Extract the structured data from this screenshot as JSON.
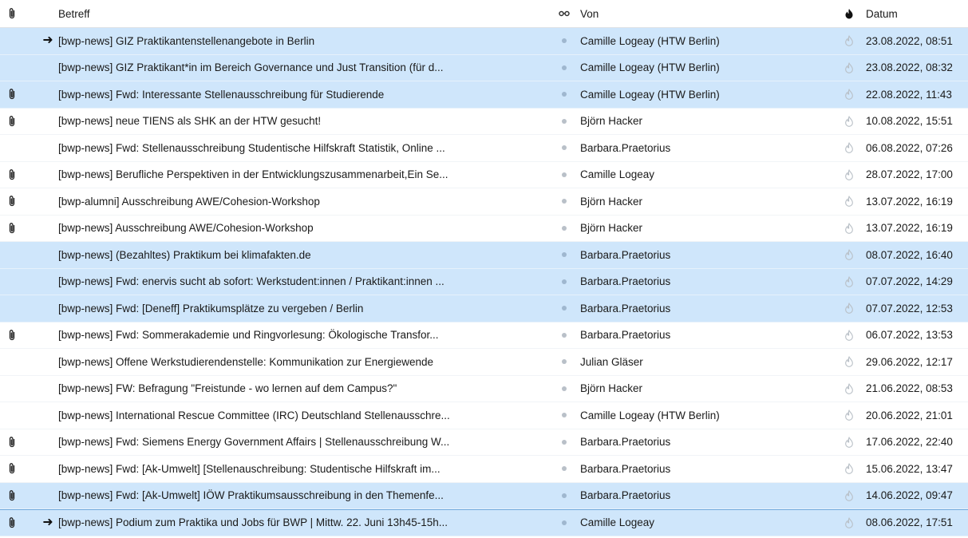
{
  "columns": {
    "subject": "Betreff",
    "from": "Von",
    "date": "Datum"
  },
  "messages": [
    {
      "attachment": false,
      "replied": true,
      "highlighted": true,
      "selected": false,
      "subject": "[bwp-news] GIZ Praktikantenstellenangebote in Berlin",
      "from": "Camille Logeay (HTW Berlin)",
      "date": "23.08.2022, 08:51"
    },
    {
      "attachment": false,
      "replied": false,
      "highlighted": true,
      "selected": false,
      "subject": "[bwp-news] GIZ Praktikant*in im Bereich Governance und Just Transition (für d...",
      "from": "Camille Logeay (HTW Berlin)",
      "date": "23.08.2022, 08:32"
    },
    {
      "attachment": true,
      "replied": false,
      "highlighted": true,
      "selected": false,
      "subject": "[bwp-news] Fwd: Interessante Stellenausschreibung für Studierende",
      "from": "Camille Logeay (HTW Berlin)",
      "date": "22.08.2022, 11:43"
    },
    {
      "attachment": true,
      "replied": false,
      "highlighted": false,
      "selected": false,
      "subject": "[bwp-news] neue TIENS als SHK an der HTW gesucht!",
      "from": "Björn Hacker",
      "date": "10.08.2022, 15:51"
    },
    {
      "attachment": false,
      "replied": false,
      "highlighted": false,
      "selected": false,
      "subject": "[bwp-news] Fwd: Stellenausschreibung Studentische Hilfskraft Statistik, Online ...",
      "from": "Barbara.Praetorius",
      "date": "06.08.2022, 07:26"
    },
    {
      "attachment": true,
      "replied": false,
      "highlighted": false,
      "selected": false,
      "subject": "[bwp-news] Berufliche Perspektiven in der Entwicklungszusammenarbeit,Ein Se...",
      "from": "Camille Logeay",
      "date": "28.07.2022, 17:00"
    },
    {
      "attachment": true,
      "replied": false,
      "highlighted": false,
      "selected": false,
      "subject": "[bwp-alumni] Ausschreibung AWE/Cohesion-Workshop",
      "from": "Björn Hacker",
      "date": "13.07.2022, 16:19"
    },
    {
      "attachment": true,
      "replied": false,
      "highlighted": false,
      "selected": false,
      "subject": "[bwp-news] Ausschreibung AWE/Cohesion-Workshop",
      "from": "Björn Hacker",
      "date": "13.07.2022, 16:19"
    },
    {
      "attachment": false,
      "replied": false,
      "highlighted": true,
      "selected": false,
      "subject": "[bwp-news] (Bezahltes) Praktikum bei klimafakten.de",
      "from": "Barbara.Praetorius",
      "date": "08.07.2022, 16:40"
    },
    {
      "attachment": false,
      "replied": false,
      "highlighted": true,
      "selected": false,
      "subject": "[bwp-news] Fwd: enervis sucht ab sofort: Werkstudent:innen / Praktikant:innen ...",
      "from": "Barbara.Praetorius",
      "date": "07.07.2022, 14:29"
    },
    {
      "attachment": false,
      "replied": false,
      "highlighted": true,
      "selected": false,
      "subject": "[bwp-news] Fwd: [Deneff] Praktikumsplätze zu vergeben / Berlin",
      "from": "Barbara.Praetorius",
      "date": "07.07.2022, 12:53"
    },
    {
      "attachment": true,
      "replied": false,
      "highlighted": false,
      "selected": false,
      "subject": "[bwp-news] Fwd: Sommerakademie und Ringvorlesung: Ökologische Transfor...",
      "from": "Barbara.Praetorius",
      "date": "06.07.2022, 13:53"
    },
    {
      "attachment": false,
      "replied": false,
      "highlighted": false,
      "selected": false,
      "subject": "[bwp-news] Offene Werkstudierendenstelle: Kommunikation zur Energiewende",
      "from": "Julian Gläser",
      "date": "29.06.2022, 12:17"
    },
    {
      "attachment": false,
      "replied": false,
      "highlighted": false,
      "selected": false,
      "subject": "[bwp-news] FW: Befragung \"Freistunde - wo lernen auf dem Campus?\"",
      "from": "Björn Hacker",
      "date": "21.06.2022, 08:53"
    },
    {
      "attachment": false,
      "replied": false,
      "highlighted": false,
      "selected": false,
      "subject": "[bwp-news] International Rescue Committee (IRC) Deutschland Stellenausschre...",
      "from": "Camille Logeay (HTW Berlin)",
      "date": "20.06.2022, 21:01"
    },
    {
      "attachment": true,
      "replied": false,
      "highlighted": false,
      "selected": false,
      "subject": "[bwp-news] Fwd: Siemens Energy Government Affairs | Stellenausschreibung W...",
      "from": "Barbara.Praetorius",
      "date": "17.06.2022, 22:40"
    },
    {
      "attachment": true,
      "replied": false,
      "highlighted": false,
      "selected": false,
      "subject": "[bwp-news] Fwd: [Ak-Umwelt] [Stellenauschreibung: Studentische Hilfskraft im...",
      "from": "Barbara.Praetorius",
      "date": "15.06.2022, 13:47"
    },
    {
      "attachment": true,
      "replied": false,
      "highlighted": true,
      "selected": false,
      "subject": "[bwp-news] Fwd: [Ak-Umwelt] IÖW Praktikumsausschreibung in den Themenfe...",
      "from": "Barbara.Praetorius",
      "date": "14.06.2022, 09:47"
    },
    {
      "attachment": true,
      "replied": true,
      "highlighted": true,
      "selected": true,
      "subject": "[bwp-news] Podium zum Praktika und Jobs für BWP | Mittw. 22. Juni 13h45-15h...",
      "from": "Camille Logeay",
      "date": "08.06.2022, 17:51"
    }
  ],
  "icons": {
    "attachment": "paperclip-icon",
    "thread": "thread-icon",
    "junk": "flame-icon",
    "replied": "arrow-right-icon",
    "read_status": "dot-icon",
    "junk_status": "flame-outline-icon"
  },
  "colors": {
    "highlight_row": "#cfe6fb",
    "selection_border": "#6fa8dc"
  }
}
